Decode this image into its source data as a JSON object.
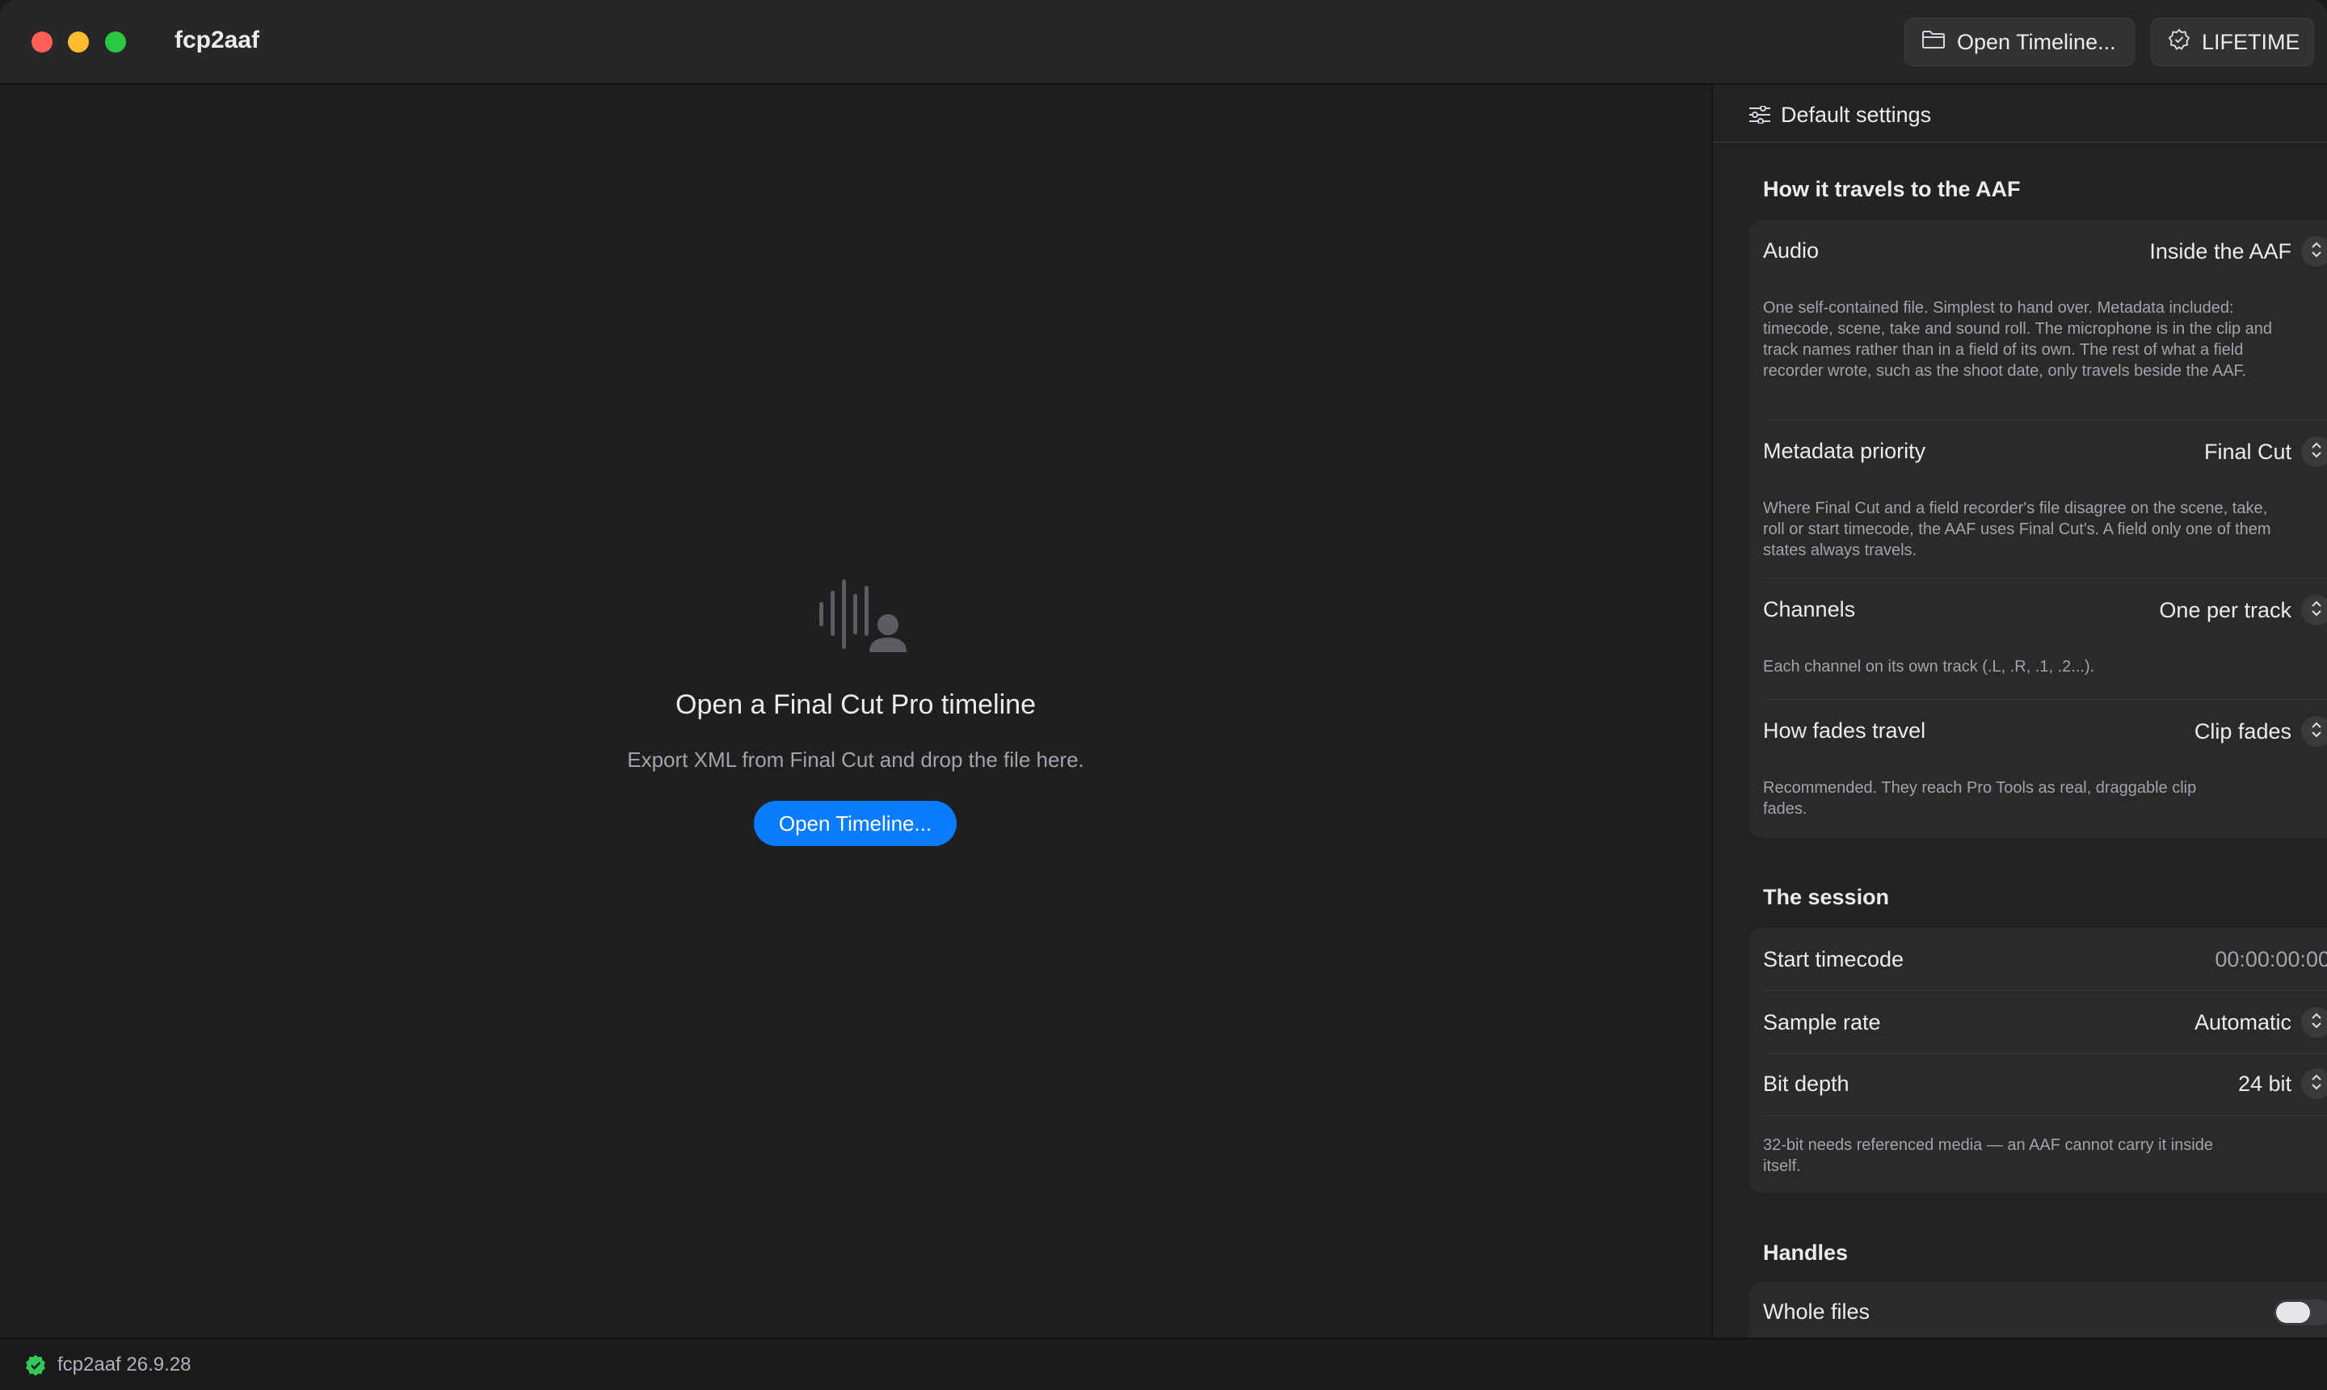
{
  "app": {
    "title": "fcp2aaf"
  },
  "toolbar": {
    "open_timeline_label": "Open Timeline...",
    "lifetime_label": "LIFETIME"
  },
  "empty_state": {
    "title": "Open a Final Cut Pro timeline",
    "subtitle": "Export XML from Final Cut and drop the file here.",
    "button_label": "Open Timeline..."
  },
  "sidebar": {
    "header_label": "Default settings",
    "sections": {
      "travel": {
        "title": "How it travels to the AAF",
        "rows": {
          "audio": {
            "label": "Audio",
            "value": "Inside the AAF",
            "description": "One self-contained file. Simplest to hand over. Metadata included: timecode, scene, take and sound roll. The microphone is in the clip and track names rather than in a field of its own. The rest of what a field recorder wrote, such as the shoot date, only travels beside the AAF."
          },
          "metadata_priority": {
            "label": "Metadata priority",
            "value": "Final Cut",
            "description": "Where Final Cut and a field recorder's file disagree on the scene, take, roll or start timecode, the AAF uses Final Cut's. A field only one of them states always travels."
          },
          "channels": {
            "label": "Channels",
            "value": "One per track",
            "description": "Each channel on its own track (.L, .R, .1, .2...)."
          },
          "fades": {
            "label": "How fades travel",
            "value": "Clip fades",
            "description": "Recommended. They reach Pro Tools as real, draggable clip fades."
          }
        }
      },
      "session": {
        "title": "The session",
        "rows": {
          "start_timecode": {
            "label": "Start timecode",
            "value": "00:00:00:00"
          },
          "sample_rate": {
            "label": "Sample rate",
            "value": "Automatic"
          },
          "bit_depth": {
            "label": "Bit depth",
            "value": "24 bit",
            "description": "32-bit needs referenced media — an AAF cannot carry it inside itself."
          }
        }
      },
      "handles": {
        "title": "Handles",
        "rows": {
          "whole_files": {
            "label": "Whole files",
            "enabled": false
          }
        }
      }
    }
  },
  "status": {
    "text": "fcp2aaf 26.9.28",
    "icon": "verified-check-icon",
    "icon_color": "#34c759"
  },
  "colors": {
    "accent": "#0a7cff",
    "close": "#ff5f57",
    "minimize": "#febc2e",
    "maximize": "#28c840"
  }
}
